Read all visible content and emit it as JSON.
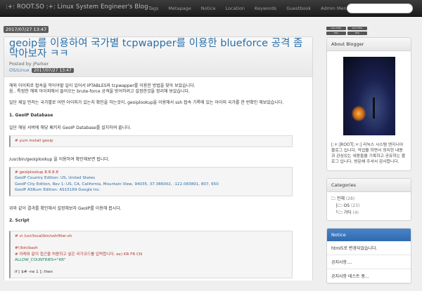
{
  "navbar": {
    "brand": ":+: ROOT.SO :+: Linux System Engineer's Blog",
    "items": [
      "Tags",
      "Metapage",
      "Notice",
      "Location",
      "Keywords",
      "Guestbook",
      "Admin Menu▾"
    ]
  },
  "post": {
    "date": "2017/07/27 13:47",
    "title": "geoip를 이용하여 국가별 tcpwapper를 이용한 blueforce 공격 좀 막아보자 ㅋㅋ",
    "author": "Posted by jParker",
    "category": "OS/Linux",
    "stamp": "2017/07/27 13:47",
    "paragraphs": [
      "해외 아이피로 접속을 막아야할 일이 있어서 IPTABLES와 tcpwapper를 이용한 방법을 찾아 보았습니다.",
      "음.. 특정한 해외 아이피에서 들어오는 brute-force 공격을 방어하려고 설정한것을 정리해 보았습니다.",
      "일단 제일 먼저는 국가별로 어떤 아이피가 있는지 확인을 하는것이, geoiplookup을 이용해서 ssh 접속 기록에 있는 아이피 국가를 한 번확인 해보았습니다."
    ],
    "section1": "1. GeoIP Database",
    "section1_text": "일단 해당 서버에 해당 패키지 GeoIP Database를 설치하여 줍니다.",
    "code1": "# yum install geoip",
    "after_code1": "/usr/bin/geoiplookup 을 이용하여 확인해보면 됩니다.",
    "code2": [
      "# geoiplookup 8.8.8.8",
      "GeoIP Country Edition: US, United States",
      "GeoIP City Edition, Rev 1: US, CA, California, Mountain View, 94035, 37.386002, -122.083801, 807, 650",
      "GeoIP ASNum Edition: AS15169 Google Inc."
    ],
    "after_code2": "위와 같이 결과를 확인해서 설정해보자 GeoIP를 이용해 봅시다.",
    "section2": "2. Script",
    "code3": [
      "# vi /usr/local/bin/sshfilter.sh",
      "",
      "#!/bin/bash",
      "# 아래와 같이 접근을 허용하고 싶은 국가코드를 입력합니다. ex) KR FR CN",
      "ALLOW_COUNTRIES=\"KR\"",
      "",
      "if [ $# -ne 1 ]; then"
    ]
  },
  "sidebar": {
    "badges": [
      "RSS FEED",
      "RSS FEED",
      "RSS",
      "RSS"
    ],
    "about_title": "About Blogger",
    "about_text": "[:+:]ROOT[:+:] 리눅스 시스템 엔지니어 블로그 입니다. 작업을 하면서 정리한 내용과 관심있는 내용들을 기록하고 공유하는 블로그 입니다. 방문해 주셔서 감사합니다.",
    "categories_title": "Categories",
    "categories": [
      {
        "label": "전체",
        "count": "(28)"
      },
      {
        "label": "OS",
        "count": "(23)"
      },
      {
        "label": "기타",
        "count": "(4)"
      }
    ],
    "notice_title": "Notice",
    "notices": [
      "html5로 변경되었습니다.",
      "공지사항....",
      "공지사항 테스트 중..."
    ]
  }
}
